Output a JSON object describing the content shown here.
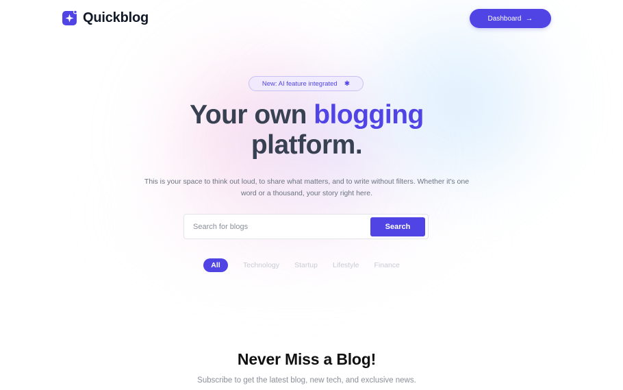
{
  "brand": {
    "name": "Quickblog",
    "accent_color": "#5044e5",
    "logo_icon": "sparkle-square-icon"
  },
  "header": {
    "dashboard_label": "Dashboard",
    "dashboard_icon": "arrow-right-icon"
  },
  "hero": {
    "badge_text": "New: AI feature integrated",
    "badge_icon": "sparkle-icon",
    "title_part1": "Your own ",
    "title_accent": "blogging",
    "title_part2": "platform.",
    "description": "This is your space to think out loud, to share what matters, and to write without filters. Whether it's one word or a thousand, your story right here."
  },
  "search": {
    "placeholder": "Search for blogs",
    "value": "",
    "button_label": "Search"
  },
  "filters": {
    "items": [
      {
        "label": "All",
        "active": true
      },
      {
        "label": "Technology",
        "active": false
      },
      {
        "label": "Startup",
        "active": false
      },
      {
        "label": "Lifestyle",
        "active": false
      },
      {
        "label": "Finance",
        "active": false
      }
    ]
  },
  "newsletter": {
    "title": "Never Miss a Blog!",
    "subtitle": "Subscribe to get the latest blog, new tech, and exclusive news."
  }
}
